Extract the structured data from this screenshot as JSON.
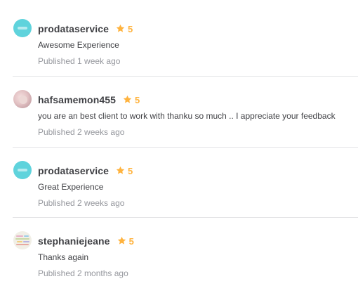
{
  "reviews": [
    {
      "username": "prodataservice",
      "rating": "5",
      "text": "Awesome Experience",
      "published": "Published 1 week ago",
      "avatar": "teal-logo-avatar"
    },
    {
      "username": "hafsamemon455",
      "rating": "5",
      "text": "you are an best client to work with thanku so much .. I appreciate your feedback",
      "published": "Published 2 weeks ago",
      "avatar": "photo-avatar"
    },
    {
      "username": "prodataservice",
      "rating": "5",
      "text": "Great Experience",
      "published": "Published 2 weeks ago",
      "avatar": "teal-logo-avatar"
    },
    {
      "username": "stephaniejeane",
      "rating": "5",
      "text": "Thanks again",
      "published": "Published 2 months ago",
      "avatar": "collage-avatar"
    }
  ],
  "colors": {
    "star": "#ffb33e",
    "username": "#404145",
    "meta": "#95979d",
    "divider": "#e4e5e7",
    "teal_avatar": "#5fd3dc"
  },
  "icons": {
    "rating": "star-icon"
  }
}
